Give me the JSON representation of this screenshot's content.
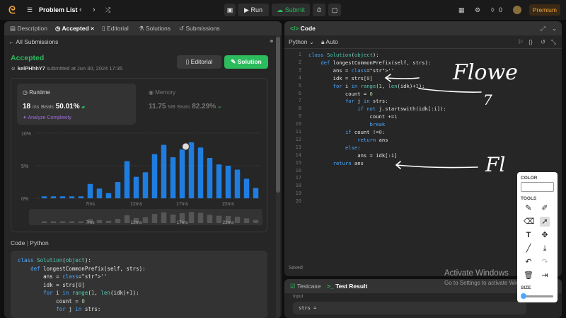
{
  "topbar": {
    "problem_list": "Problem List",
    "run": "Run",
    "submit": "Submit",
    "streak": "0",
    "premium": "Premium"
  },
  "left": {
    "tabs": [
      "Description",
      "Accepted",
      "Editorial",
      "Solutions",
      "Submissions"
    ],
    "all_submissions": "All Submissions",
    "status": "Accepted",
    "user": "kelPHhhY7",
    "submitted": "submitted at Jun 30, 2024 17:35",
    "editorial_btn": "Editorial",
    "solution_btn": "Solution",
    "runtime": {
      "label": "Runtime",
      "value": "18",
      "unit": "ms",
      "beats_label": "Beats",
      "beats": "50.01%"
    },
    "memory": {
      "label": "Memory",
      "value": "11.75",
      "unit": "MB",
      "beats_label": "Beats",
      "beats": "82.29%"
    },
    "analyze": "Analyze Complexity",
    "code_label": "Code",
    "lang": "Python",
    "code_lines": [
      "class Solution(object):",
      "    def longestCommonPrefix(self, strs):",
      "        ans = ''",
      "        idk = strs[0]",
      "        for i in range(1, len(idk)+1):",
      "            count = 0",
      "            for j in strs:"
    ]
  },
  "chart_data": {
    "type": "bar",
    "y_ticks": [
      "10%",
      "5%",
      "0%"
    ],
    "x_ticks": [
      "7ms",
      "12ms",
      "17ms",
      "22ms"
    ],
    "ylim": [
      0,
      10
    ],
    "values": [
      0.3,
      0.3,
      0.3,
      0.3,
      0.3,
      2.2,
      1.5,
      0.8,
      2.5,
      5.7,
      3.3,
      4.0,
      6.8,
      8.2,
      6.3,
      7.5,
      8.6,
      7.8,
      6.2,
      5.2,
      5.0,
      4.4,
      3.0,
      1.6
    ],
    "highlight_index": 16,
    "grid": true
  },
  "right": {
    "title": "Code",
    "lang": "Python",
    "auto": "Auto",
    "line_numbers": [
      "1",
      "2",
      "3",
      "4",
      "5",
      "6",
      "7",
      "8",
      "9",
      "10",
      "11",
      "12",
      "13",
      "14",
      "15",
      "16",
      "17",
      "18",
      "19",
      "20"
    ],
    "code_lines": [
      "class Solution(object):",
      "    def longestCommonPrefix(self, strs):",
      "        ans = ''",
      "        idk = strs[0]",
      "        for i in range(1, len(idk)+1):",
      "            count = 0",
      "            for j in strs:",
      "                if not j.startswith(idk[:i]):",
      "                    count +=1",
      "                    break",
      "            if count !=0:",
      "                return ans",
      "            else:",
      "                ans = idk[:i]",
      "        return ans",
      "",
      "",
      "",
      "",
      ""
    ],
    "saved": "Saved",
    "testcase_tab": "Testcase",
    "result_tab": "Test Result",
    "input_label": "Input",
    "strs_label": "strs ="
  },
  "drawing": {
    "colors": {
      "ink": "#ffffff"
    },
    "word_top": "Flowe",
    "digit": "7",
    "word_bottom": "Fl"
  },
  "toolpanel": {
    "color_label": "COLOR",
    "tools_label": "TOOLS",
    "size_label": "SIZE"
  },
  "watermark": {
    "title": "Activate Windows",
    "subtitle": "Go to Settings to activate Windows."
  }
}
